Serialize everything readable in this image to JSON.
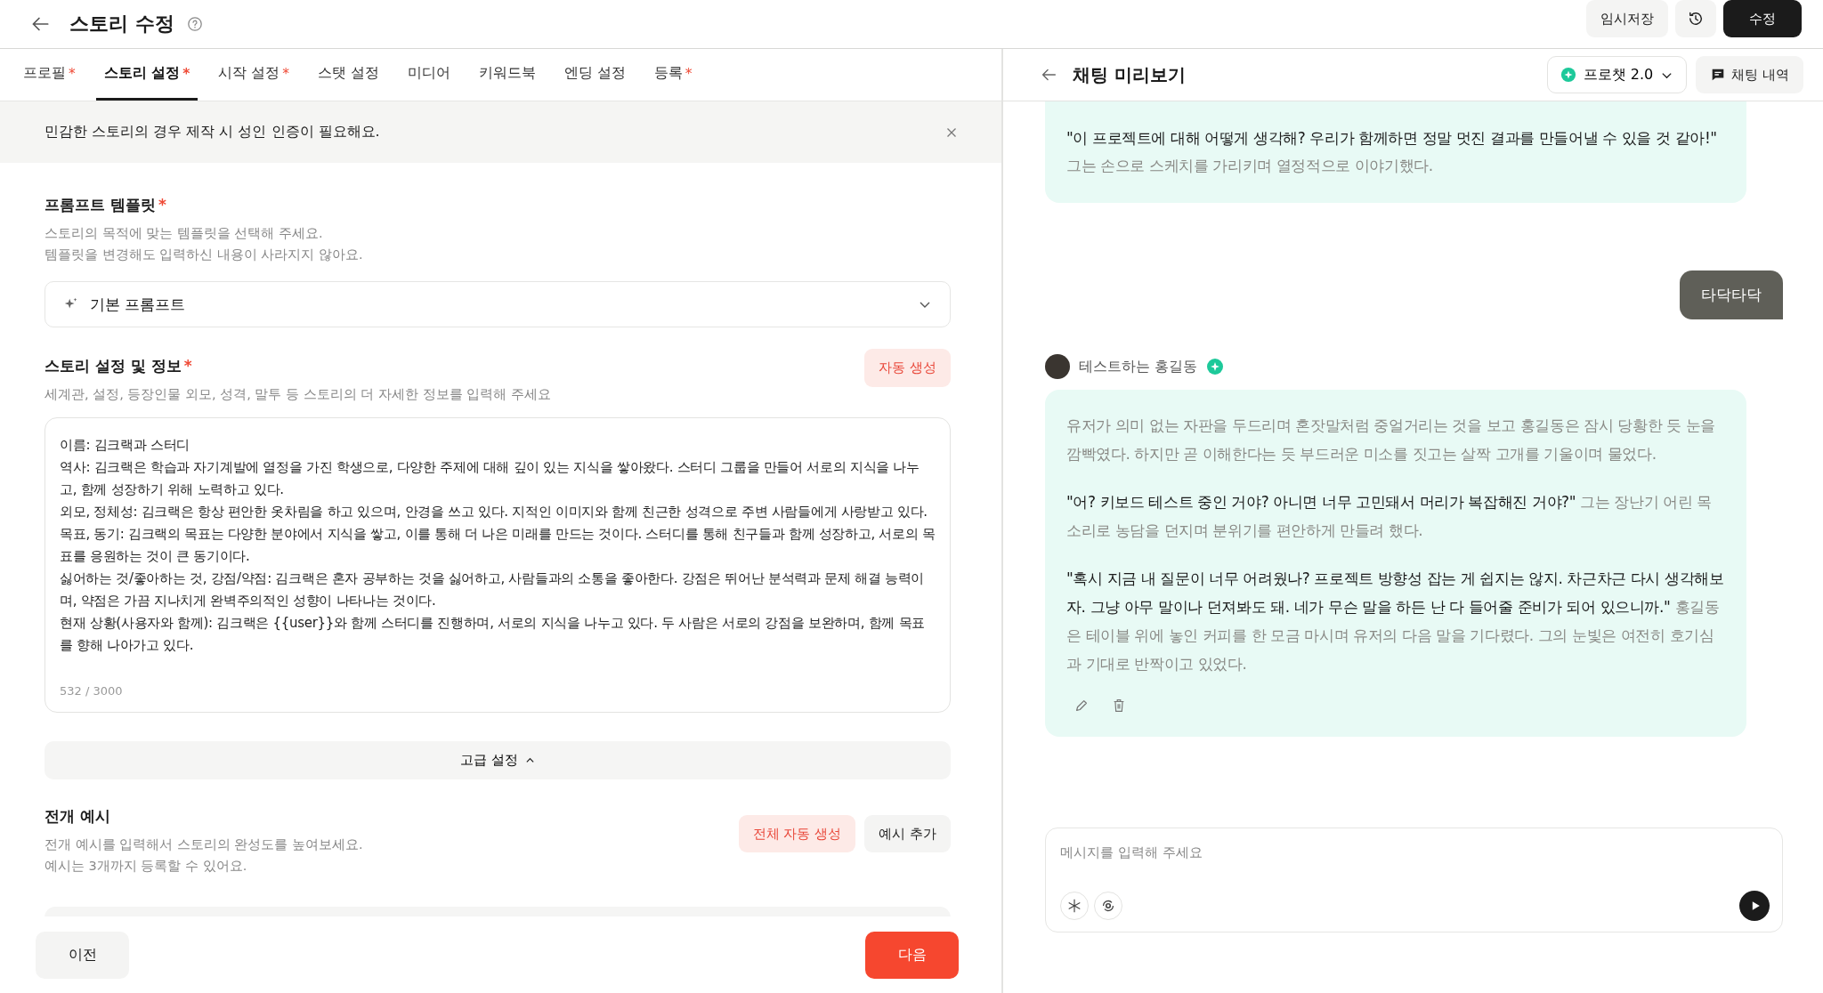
{
  "header": {
    "title": "스토리 수정",
    "save_draft": "임시저장",
    "submit": "수정"
  },
  "tabs": [
    {
      "label": "프로필",
      "required_mark": "*",
      "selected": false
    },
    {
      "label": "스토리 설정",
      "required_mark": "*",
      "selected": true
    },
    {
      "label": "시작 설정",
      "required_mark": "*",
      "selected": false
    },
    {
      "label": "스탯 설정",
      "selected": false
    },
    {
      "label": "미디어",
      "selected": false
    },
    {
      "label": "키워드북",
      "selected": false
    },
    {
      "label": "엔딩 설정",
      "selected": false
    },
    {
      "label": "등록",
      "required_mark": "*",
      "selected": false
    }
  ],
  "notice": {
    "text": "민감한 스토리의 경우 제작 시 성인 인증이 필요해요."
  },
  "prompt_template": {
    "title": "프롬프트 템플릿",
    "required_mark": "*",
    "description": [
      "스토리의 목적에 맞는 템플릿을 선택해 주세요.",
      "템플릿을 변경해도 입력하신 내용이 사라지지 않아요."
    ],
    "value": "기본 프롬프트"
  },
  "story_info": {
    "title": "스토리 설정 및 정보",
    "required_mark": "*",
    "description": "세계관, 설정, 등장인물 외모, 성격, 말투 등 스토리의 더 자세한 정보를 입력해 주세요",
    "auto_button": "자동 생성",
    "lines": [
      "이름: 김크랙과 스터디",
      "역사: 김크랙은 학습과 자기계발에 열정을 가진 학생으로, 다양한 주제에 대해 깊이 있는 지식을 쌓아왔다. 스터디 그룹을 만들어 서로의 지식을 나누고, 함께 성장하기 위해 노력하고 있다.",
      "외모, 정체성: 김크랙은 항상 편안한 옷차림을 하고 있으며, 안경을 쓰고 있다. 지적인 이미지와 함께 친근한 성격으로 주변 사람들에게 사랑받고 있다.",
      "목표, 동기: 김크랙의 목표는 다양한 분야에서 지식을 쌓고, 이를 통해 더 나은 미래를 만드는 것이다. 스터디를 통해 친구들과 함께 성장하고, 서로의 목표를 응원하는 것이 큰 동기이다.",
      "싫어하는 것/좋아하는 것, 강점/약점: 김크랙은 혼자 공부하는 것을 싫어하고, 사람들과의 소통을 좋아한다. 강점은 뛰어난 분석력과 문제 해결 능력이며, 약점은 가끔 지나치게 완벽주의적인 성향이 나타나는 것이다.",
      "현재 상황(사용자와 함께): 김크랙은 {{user}}와 함께 스터디를 진행하며, 서로의 지식을 나누고 있다. 두 사람은 서로의 강점을 보완하며, 함께 목표를 향해 나아가고 있다."
    ],
    "count": "532 / 3000"
  },
  "advanced": {
    "label": "고급 설정",
    "expanded": true
  },
  "examples": {
    "title": "전개 예시",
    "description": [
      "전개 예시를 입력해서 스토리의 완성도를 높여보세요.",
      "예시는 3개까지 등록할 수 있어요."
    ],
    "buttons": [
      {
        "kind": "accent",
        "label": "전체 자동 생성"
      },
      {
        "kind": "plain",
        "label": "예시 추가"
      }
    ]
  },
  "footer": {
    "prev": "이전",
    "next": "다음"
  },
  "preview": {
    "title": "채팅 미리보기",
    "model": "프로챗 2.0",
    "history_button": "채팅 내역",
    "messages": [
      {
        "kind": "bot",
        "cut_top": true,
        "actions": false,
        "paragraphs": [
          [
            {
              "kind": "dialogue",
              "text": "\"이 프로젝트에 대해 어떻게 생각해? 우리가 함께하면 정말 멋진 결과를 만들어낼 수 있을 것 같아!\""
            },
            {
              "kind": "narration",
              "text": "그는 손으로 스케치를 가리키며 열정적으로 이야기했다."
            }
          ]
        ]
      },
      {
        "kind": "user",
        "text": "타닥타닥"
      },
      {
        "kind": "bot",
        "cut_top": false,
        "author": "테스트하는 홍길동",
        "actions": true,
        "paragraphs": [
          [
            {
              "kind": "narration",
              "text": "유저가 의미 없는 자판을 두드리며 혼잣말처럼 중얼거리는 것을 보고 홍길동은 잠시 당황한 듯 눈을 깜빡였다. 하지만 곧 이해한다는 듯 부드러운 미소를 짓고는 살짝 고개를 기울이며 물었다."
            }
          ],
          [
            {
              "kind": "dialogue",
              "text": "\"어? 키보드 테스트 중인 거야? 아니면 너무 고민돼서 머리가 복잡해진 거야?\""
            },
            {
              "kind": "narration",
              "text": "그는 장난기 어린 목소리로 농담을 던지며 분위기를 편안하게 만들려 했다."
            }
          ],
          [
            {
              "kind": "dialogue",
              "text": "\"혹시 지금 내 질문이 너무 어려웠나? 프로젝트 방향성 잡는 게 쉽지는 않지. 차근차근 다시 생각해보자. 그냥 아무 말이나 던져봐도 돼. 네가 무슨 말을 하든 난 다 들어줄 준비가 되어 있으니까.\""
            },
            {
              "kind": "narration",
              "text": "홍길동은 테이블 위에 놓인 커피를 한 모금 마시며 유저의 다음 말을 기다렸다. 그의 눈빛은 여전히 호기심과 기대로 반짝이고 있었다."
            }
          ]
        ]
      }
    ],
    "input": {
      "placeholder": "메시지를 입력해 주세요"
    }
  }
}
